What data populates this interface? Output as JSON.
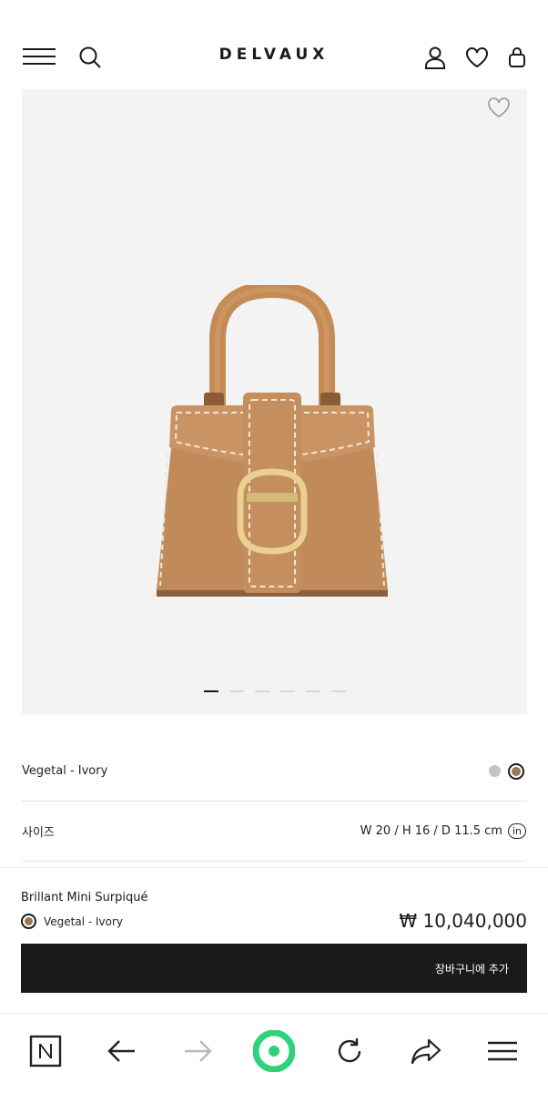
{
  "header": {
    "brand": "DELVAUX",
    "icons": [
      "menu-icon",
      "search-icon",
      "account-icon",
      "wishlist-icon",
      "bag-icon"
    ]
  },
  "gallery": {
    "image_alt": "Brillant Mini Surpiqué handbag",
    "slide_count": 6,
    "active_slide": 1
  },
  "options": {
    "color_label": "Vegetal - Ivory",
    "size_label": "사이즈",
    "size_value": "W 20 / H 16 / D 11.5 cm",
    "unit_toggle": "in"
  },
  "purchase": {
    "product_name": "Brillant Mini Surpiqué",
    "selected_color": "Vegetal - Ivory",
    "price": "₩ 10,040,000",
    "add_to_cart": "장바구니에 추가"
  },
  "colors": {
    "swatch_grey": "#c4c4c2",
    "swatch_brown": "#9a7755",
    "accent_green": "#2fd27a",
    "button_bg": "#1a1a1a"
  },
  "browser_toolbar": [
    "naver-home-icon",
    "back-icon",
    "forward-icon",
    "green-dot-icon",
    "reload-icon",
    "share-icon",
    "menu-icon"
  ]
}
